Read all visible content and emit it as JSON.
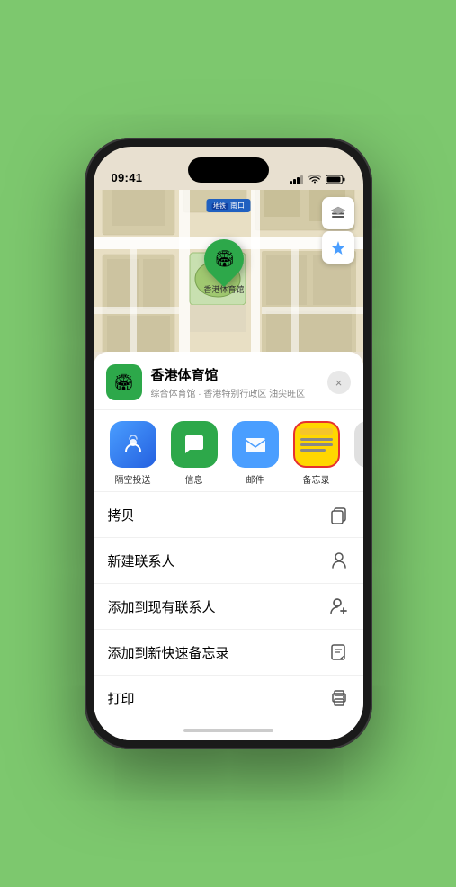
{
  "status_bar": {
    "time": "09:41",
    "location_icon": "▶"
  },
  "map": {
    "metro_label": "南口",
    "venue_marker_label": "香港体育馆",
    "map_layer_icon": "🗺",
    "location_icon": "⬆"
  },
  "sheet": {
    "venue_icon": "🏟",
    "venue_name": "香港体育馆",
    "venue_subtitle": "综合体育馆 · 香港特别行政区 油尖旺区",
    "close_label": "×"
  },
  "share_items": [
    {
      "id": "airdrop",
      "label": "隔空投送"
    },
    {
      "id": "messages",
      "label": "信息"
    },
    {
      "id": "mail",
      "label": "邮件"
    },
    {
      "id": "notes",
      "label": "备忘录"
    },
    {
      "id": "more",
      "label": "提"
    }
  ],
  "actions": [
    {
      "label": "拷贝",
      "icon": "copy"
    },
    {
      "label": "新建联系人",
      "icon": "person"
    },
    {
      "label": "添加到现有联系人",
      "icon": "person-add"
    },
    {
      "label": "添加到新快速备忘录",
      "icon": "note"
    },
    {
      "label": "打印",
      "icon": "print"
    }
  ]
}
